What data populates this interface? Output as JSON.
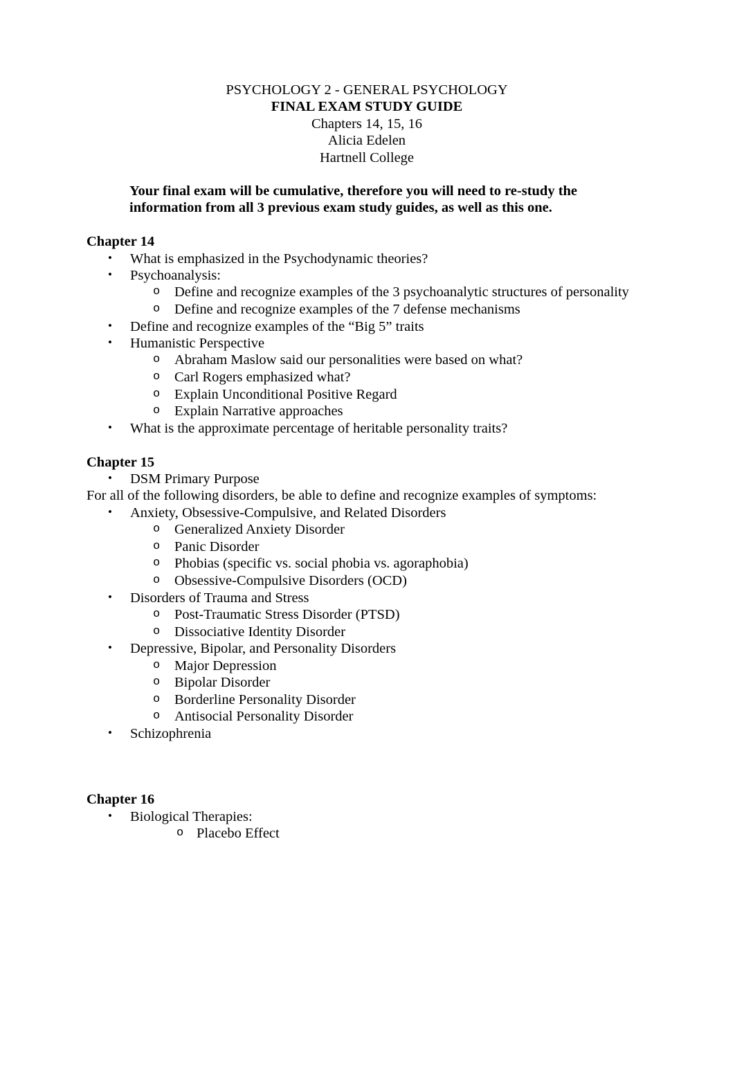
{
  "document": {
    "title_block": {
      "line1": "PSYCHOLOGY 2 - GENERAL PSYCHOLOGY",
      "line2": "FINAL EXAM STUDY GUIDE",
      "line3": "Chapters 14, 15, 16",
      "line4": "Alicia Edelen",
      "line5": "Hartnell College"
    },
    "intro": "Your final exam will be cumulative, therefore you will need to re-study the information from all 3 previous exam study guides, as well as this one.",
    "chapter14": {
      "heading": "Chapter 14",
      "items": [
        {
          "text": "What is emphasized in the Psychodynamic theories?",
          "subitems": []
        },
        {
          "text": "Psychoanalysis:",
          "subitems": [
            "Define and recognize examples of the 3 psychoanalytic structures of personality",
            "Define and recognize examples of the 7 defense mechanisms"
          ]
        },
        {
          "text": "Define and recognize examples of the “Big 5” traits",
          "subitems": []
        },
        {
          "text": "Humanistic Perspective",
          "subitems": [
            "Abraham Maslow said our personalities were based on what?",
            "Carl Rogers emphasized what?",
            "Explain Unconditional Positive Regard",
            "Explain Narrative approaches"
          ]
        },
        {
          "text": "What is the approximate percentage of heritable personality traits?",
          "subitems": []
        }
      ]
    },
    "chapter15": {
      "heading": "Chapter 15",
      "items_before_note": [
        {
          "text": "DSM Primary Purpose",
          "subitems": []
        }
      ],
      "note": "For all of the following disorders, be able to define and recognize examples of symptoms:",
      "items": [
        {
          "text": "Anxiety, Obsessive-Compulsive, and Related Disorders",
          "subitems": [
            "Generalized Anxiety Disorder",
            "Panic Disorder",
            "Phobias (specific vs. social phobia vs. agoraphobia)",
            "Obsessive-Compulsive Disorders (OCD)"
          ]
        },
        {
          "text": "Disorders of Trauma and Stress",
          "subitems": [
            "Post-Traumatic Stress Disorder (PTSD)",
            "Dissociative Identity Disorder"
          ]
        },
        {
          "text": "Depressive, Bipolar, and Personality Disorders",
          "subitems": [
            "Major Depression",
            "Bipolar Disorder",
            "Borderline Personality Disorder",
            "Antisocial Personality Disorder"
          ]
        },
        {
          "text": "Schizophrenia",
          "subitems": []
        }
      ]
    },
    "chapter16": {
      "heading": "Chapter 16",
      "items": [
        {
          "text": "Biological Therapies:",
          "subitems": [
            "Placebo Effect"
          ]
        }
      ]
    },
    "markers": {
      "bullet": "•",
      "subbullet": "o"
    }
  }
}
